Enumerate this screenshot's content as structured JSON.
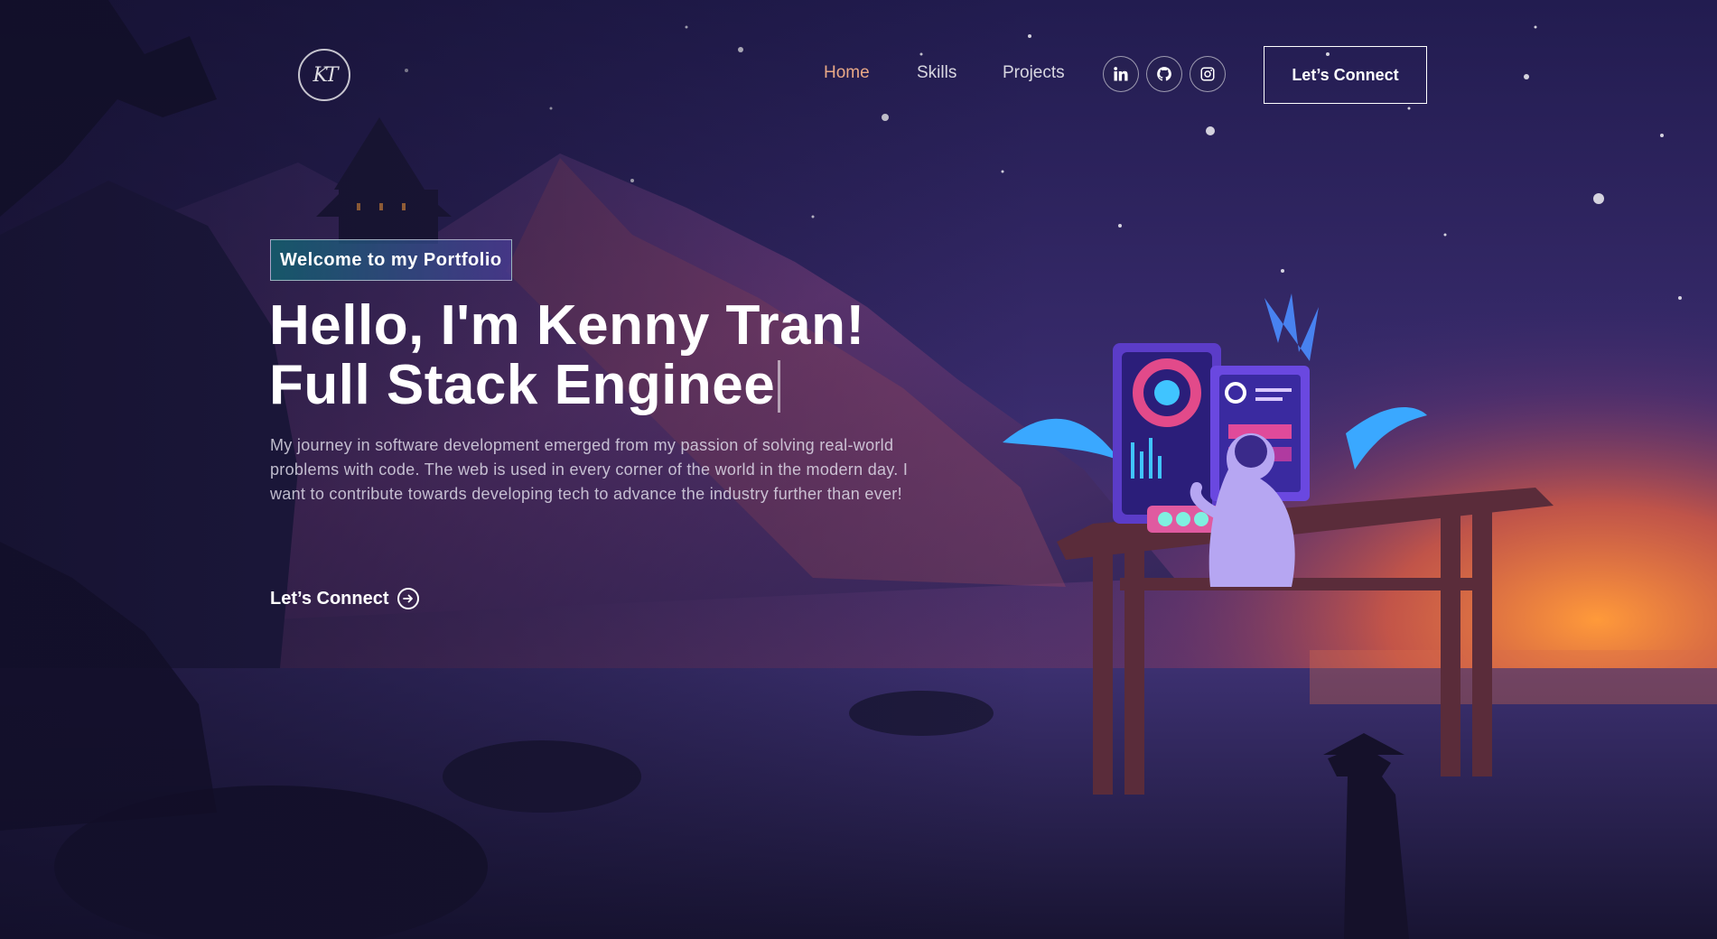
{
  "brand": {
    "logo_text": "KT"
  },
  "nav": {
    "links": [
      {
        "label": "Home",
        "active": true
      },
      {
        "label": "Skills",
        "active": false
      },
      {
        "label": "Projects",
        "active": false
      }
    ],
    "social": [
      {
        "icon": "linkedin-icon"
      },
      {
        "icon": "github-icon"
      },
      {
        "icon": "instagram-icon"
      }
    ],
    "cta_label": "Let’s Connect"
  },
  "hero": {
    "tagline": "Welcome to my Portfolio",
    "headline_line1": "Hello, I'm Kenny Tran!",
    "headline_line2": "Full Stack Enginee",
    "bio": "My journey in software development emerged from my passion of solving real-world problems with code. The web is used in every corner of the world in the modern day. I want to contribute towards developing tech to advance the industry further than ever!",
    "cta_label": "Let’s Connect",
    "cta_icon": "arrow-right-circle-icon"
  },
  "colors": {
    "active_link": "#e8a886",
    "sky_top": "#241d52",
    "sunset": "#f08a3c"
  }
}
